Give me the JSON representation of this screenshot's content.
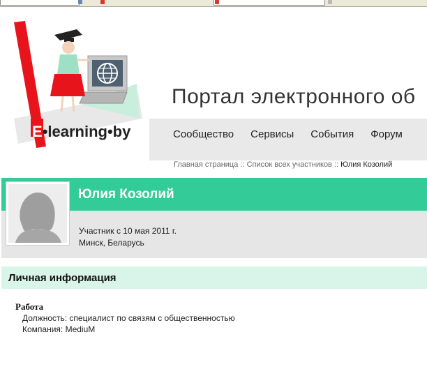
{
  "logo": {
    "text": "E•learning•by"
  },
  "header": {
    "title": "Портал электронного об",
    "nav": [
      "Сообщество",
      "Сервисы",
      "События",
      "Форум"
    ]
  },
  "breadcrumb": {
    "items": [
      "Главная страница",
      "Список всех участников"
    ],
    "separator": "::",
    "current": "Юлия Козолий"
  },
  "profile": {
    "name": "Юлия Козолий",
    "member_since": "Участник с 10 мая 2011 г.",
    "location": "Минск, Беларусь"
  },
  "personal_info": {
    "title": "Личная информация",
    "work": {
      "title": "Работа",
      "position": "Должность: специалист по связям с общественностью",
      "company": "Компания: MediuM"
    }
  },
  "colors": {
    "accent": "#33cc99",
    "section_bg": "#d9f5e9",
    "header_band": "#e9e9e9",
    "logo_red": "#e8141c"
  }
}
